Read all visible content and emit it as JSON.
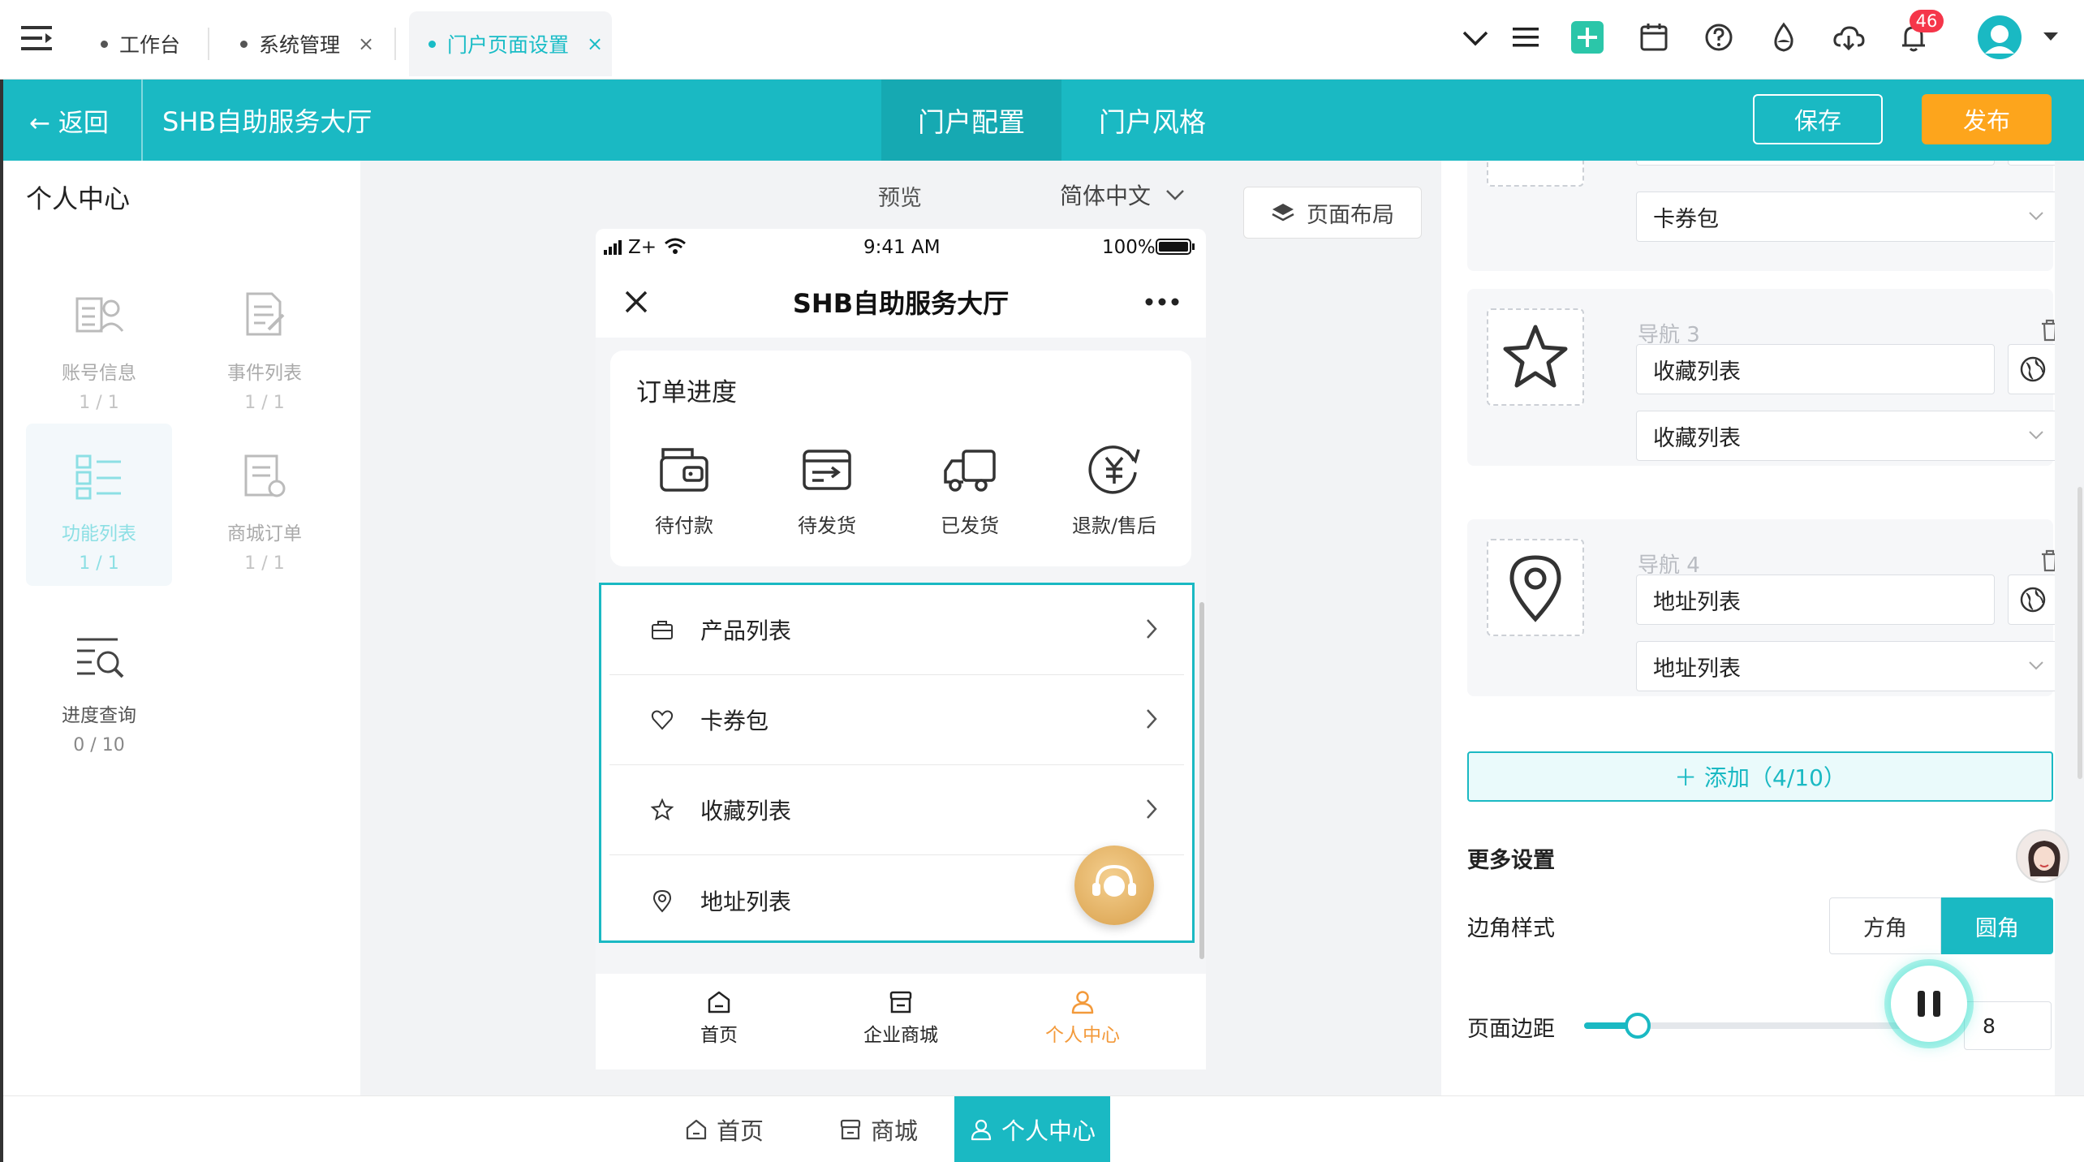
{
  "topbar": {
    "tabs": [
      {
        "label": "工作台",
        "closable": false
      },
      {
        "label": "系统管理",
        "closable": true
      },
      {
        "label": "门户页面设置",
        "closable": true,
        "active": true
      }
    ],
    "close_glyph": "×",
    "notification_count": "46",
    "icons": [
      "chevron-down-icon",
      "list-icon",
      "add-icon",
      "calendar-icon",
      "help-icon",
      "fire-icon",
      "cloud-icon",
      "bell-icon",
      "user-avatar"
    ]
  },
  "header": {
    "back_label": "← 返回",
    "title": "SHB自助服务大厅",
    "tabs": [
      "门户配置",
      "门户风格"
    ],
    "save_label": "保存",
    "publish_label": "发布"
  },
  "left": {
    "title": "个人中心",
    "components": [
      {
        "label": "账号信息",
        "count": "1 / 1"
      },
      {
        "label": "事件列表",
        "count": "1 / 1"
      },
      {
        "label": "功能列表",
        "count": "1 / 1"
      },
      {
        "label": "商城订单",
        "count": "1 / 1"
      },
      {
        "label": "进度查询",
        "count": "0 / 10"
      }
    ]
  },
  "canvas": {
    "preview_label": "预览",
    "language": "简体中文",
    "layout_button": "页面布局"
  },
  "phone": {
    "status": {
      "carrier": "Z+",
      "time": "9:41 AM",
      "battery": "100%"
    },
    "title": "SHB自助服务大厅",
    "order": {
      "title": "订单进度",
      "items": [
        "待付款",
        "待发货",
        "已发货",
        "退款/售后"
      ]
    },
    "list": [
      "产品列表",
      "卡券包",
      "收藏列表",
      "地址列表"
    ],
    "tabbar": [
      "首页",
      "企业商城",
      "个人中心"
    ]
  },
  "right": {
    "partial_select": "卡券包",
    "navs": [
      {
        "label": "导航 3",
        "name": "收藏列表",
        "link": "收藏列表"
      },
      {
        "label": "导航 4",
        "name": "地址列表",
        "link": "地址列表"
      }
    ],
    "add_label": "＋ 添加（4/10）",
    "more_title": "更多设置",
    "corner_label": "边角样式",
    "corner_options": [
      "方角",
      "圆角"
    ],
    "margin_label": "页面边距",
    "margin_value": "8",
    "margin_fraction": 0.15
  },
  "bottom": {
    "tabs": [
      "首页",
      "商城",
      "个人中心"
    ]
  },
  "colors": {
    "accent": "#1ab9c3",
    "publish": "#fda51c",
    "badge": "#f5364a",
    "tab_active": "#f39a3b"
  }
}
